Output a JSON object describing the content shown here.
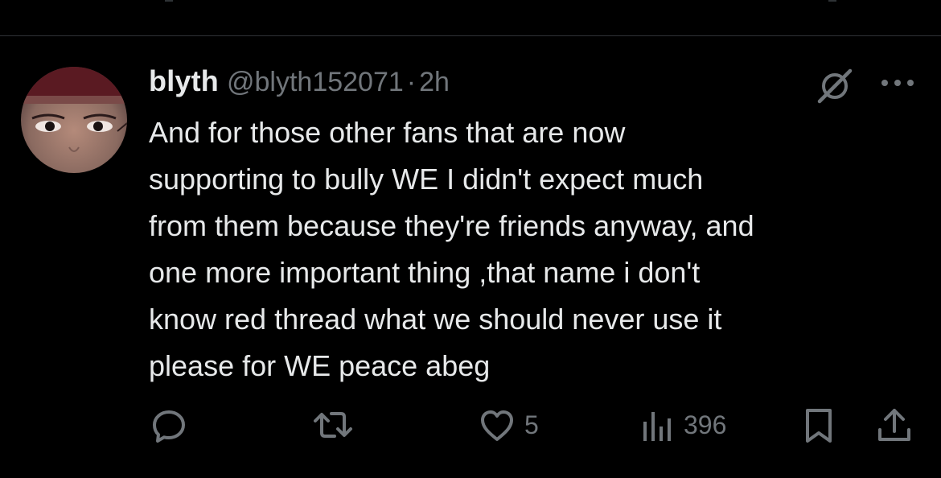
{
  "tweet": {
    "display_name": "blyth",
    "handle": "@blyth152071",
    "separator": "·",
    "time": "2h",
    "text": "And for those other fans that are now\nsupporting to bully WE I didn't expect much\nfrom them because they're friends anyway, and\none more important thing ,that name i don't\nknow red thread what we should never use it\nplease for WE peace abeg"
  },
  "actions": {
    "reply_count": "",
    "retweet_count": "",
    "like_count": "5",
    "view_count": "396"
  },
  "icons": {
    "reply": "reply-icon",
    "retweet": "retweet-icon",
    "like": "heart-icon",
    "views": "views-icon",
    "bookmark": "bookmark-icon",
    "share": "share-icon",
    "grok": "grok-icon",
    "more": "more-icon"
  },
  "colors": {
    "background": "#000000",
    "text": "#e7e9ea",
    "muted": "#71767b",
    "divider": "#2f3336"
  }
}
